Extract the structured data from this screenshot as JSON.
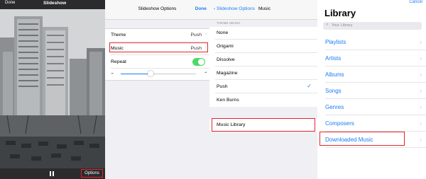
{
  "player": {
    "done_label": "Done",
    "title": "Slideshow",
    "options_label": "Options"
  },
  "options_panel": {
    "title": "Slideshow Options",
    "done_label": "Done",
    "rows": [
      {
        "label": "Theme",
        "value": "Push"
      },
      {
        "label": "Music",
        "value": "Push"
      },
      {
        "label": "Repeat",
        "value": ""
      }
    ],
    "repeat_on": true,
    "speed_level": 0.4
  },
  "music_panel": {
    "back_label": "Slideshow Options",
    "title": "Music",
    "section_label": "THEME MUSIC",
    "items": [
      "None",
      "Origami",
      "Dissolve",
      "Magazine",
      "Push",
      "Ken Burns"
    ],
    "selected": "Push",
    "library_label": "Music Library"
  },
  "library_panel": {
    "cancel_label": "Cancel",
    "title": "Library",
    "search_placeholder": "Your Library",
    "items": [
      "Playlists",
      "Artists",
      "Albums",
      "Songs",
      "Genres",
      "Composers",
      "Downloaded Music"
    ]
  },
  "colors": {
    "accent": "#1a7cf4",
    "highlight": "#e1262b",
    "toggle_on": "#4cd964"
  }
}
